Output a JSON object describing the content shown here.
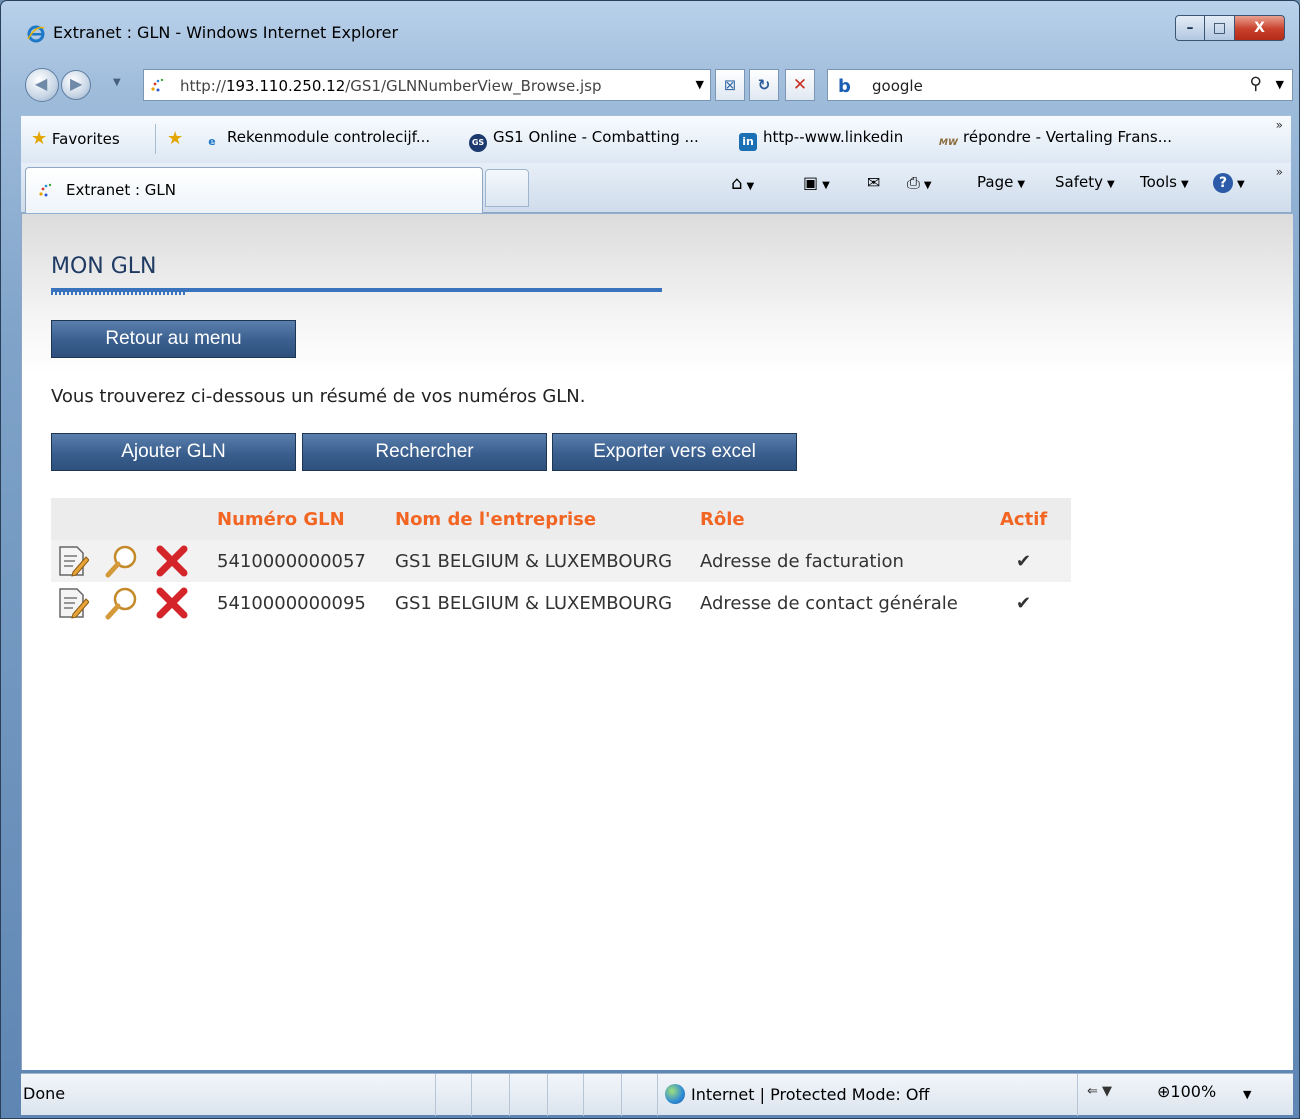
{
  "window": {
    "title": "Extranet : GLN - Windows Internet Explorer",
    "controls": {
      "minimize": "–",
      "maximize": "□",
      "close": "X"
    }
  },
  "addressbar": {
    "url_prefix": "http://",
    "url_host": "193.110.250.12",
    "url_path": "/GS1/GLNNumberView_Browse.jsp",
    "search_text": "google"
  },
  "favorites": {
    "label": "Favorites",
    "items": [
      "Rekenmodule controlecijf...",
      "GS1 Online - Combatting ...",
      "http--www.linkedin",
      "répondre - Vertaling Frans..."
    ]
  },
  "tabs": {
    "active": "Extranet : GLN"
  },
  "commandbar": {
    "page": "Page",
    "safety": "Safety",
    "tools": "Tools"
  },
  "page": {
    "title": "MON GLN",
    "back_button": "Retour au menu",
    "intro": "Vous trouverez ci-dessous un résumé de vos numéros GLN.",
    "actions": {
      "add": "Ajouter GLN",
      "search": "Rechercher",
      "export": "Exporter vers excel"
    },
    "table": {
      "headers": [
        "Numéro GLN",
        "Nom de l'entreprise",
        "Rôle",
        "Actif"
      ],
      "rows": [
        {
          "gln": "5410000000057",
          "company": "GS1 BELGIUM & LUXEMBOURG",
          "role": "Adresse de facturation",
          "active": "✔"
        },
        {
          "gln": "5410000000095",
          "company": "GS1 BELGIUM & LUXEMBOURG",
          "role": "Adresse de contact générale",
          "active": "✔"
        }
      ]
    }
  },
  "statusbar": {
    "status": "Done",
    "zone": "Internet | Protected Mode: Off",
    "zoom": "100%"
  },
  "colors": {
    "header_text": "#f26522",
    "button_bg": "#3a5f8e",
    "title_rule": "#3a73bd"
  }
}
